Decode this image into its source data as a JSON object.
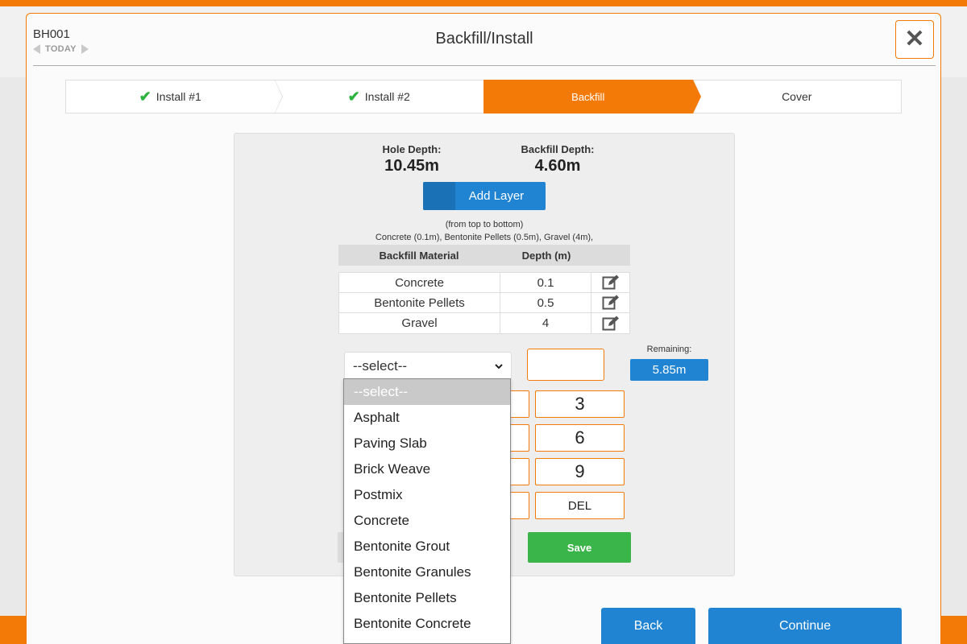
{
  "header": {
    "record_id": "BH001",
    "date_label": "TODAY",
    "title": "Backfill/Install",
    "close_icon": "close-icon"
  },
  "steps": [
    {
      "label": "Install #1",
      "done": true
    },
    {
      "label": "Install #2",
      "done": true
    },
    {
      "label": "Backfill",
      "active": true
    },
    {
      "label": "Cover"
    }
  ],
  "summary": {
    "hole_depth_label": "Hole Depth:",
    "hole_depth_value": "10.45m",
    "backfill_depth_label": "Backfill Depth:",
    "backfill_depth_value": "4.60m"
  },
  "add_layer_label": "Add Layer",
  "order_note": "(from top to bottom)",
  "layers_summary": "Concrete (0.1m), Bentonite Pellets (0.5m), Gravel (4m),",
  "table": {
    "headers": [
      "Backfill Material",
      "Depth (m)"
    ],
    "rows": [
      {
        "material": "Concrete",
        "depth": "0.1"
      },
      {
        "material": "Bentonite Pellets",
        "depth": "0.5"
      },
      {
        "material": "Gravel",
        "depth": "4"
      }
    ],
    "edit_icon": "edit-icon"
  },
  "material_select": {
    "value": "--select--",
    "options": [
      "--select--",
      "Asphalt",
      "Paving Slab",
      "Brick Weave",
      "Postmix",
      "Concrete",
      "Bentonite Grout",
      "Bentonite Granules",
      "Bentonite Pellets",
      "Bentonite Concrete"
    ]
  },
  "depth_input": {
    "value": ""
  },
  "remaining": {
    "label": "Remaining:",
    "value": "5.85m"
  },
  "keypad": {
    "k3": "3",
    "k6": "6",
    "k9": "9",
    "del": "DEL"
  },
  "save_label": "Save",
  "footer": {
    "back_label": "Back",
    "continue_label": "Continue"
  },
  "colors": {
    "accent": "#f47a07",
    "primary": "#2084d2",
    "success": "#39b54a",
    "check": "#2db33d"
  }
}
